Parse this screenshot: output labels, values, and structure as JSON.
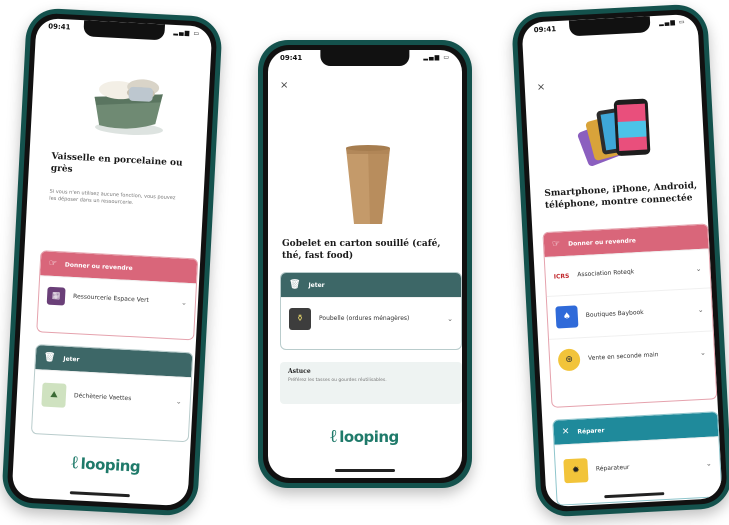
{
  "phones": [
    {
      "time": "09:41",
      "title": "Vaisselle en porcelaine ou grès",
      "description": "Si vous n'en utilisez aucune fonction, vous pouvez les déposer dans un ressourcerie.",
      "cards": [
        {
          "header": "Donner ou revendre",
          "items": [
            {
              "label": "Ressourcerie Espace Vert"
            }
          ]
        },
        {
          "header": "Jeter",
          "items": [
            {
              "label": "Déchèterie Vaettes"
            }
          ]
        }
      ],
      "logo": "looping"
    },
    {
      "time": "09:41",
      "close": "×",
      "title": "Gobelet en carton souillé (café, thé, fast food)",
      "cards": [
        {
          "header": "Jeter",
          "items": [
            {
              "label": "Poubelle (ordures ménagères)"
            }
          ]
        }
      ],
      "note_title": "Astuce",
      "note_body": "Préférez les tasses ou gourdes réutilisables.",
      "logo": "looping"
    },
    {
      "time": "09:41",
      "close": "×",
      "title": "Smartphone, iPhone, Android, téléphone, montre connectée",
      "cards": [
        {
          "header": "Donner ou revendre",
          "items": [
            {
              "label": "Association Roteqk",
              "tag": "ICRS"
            },
            {
              "label": "Boutiques Baybook"
            },
            {
              "label": "Vente en seconde main"
            }
          ]
        },
        {
          "header": "Réparer",
          "items": [
            {
              "label": "Réparateur"
            }
          ]
        }
      ]
    }
  ],
  "colors": {
    "teal_frame": "#14524d",
    "pink": "#d9667a",
    "teal": "#3d6767",
    "blue": "#1f8a9b",
    "logo": "#1f7a6a"
  }
}
